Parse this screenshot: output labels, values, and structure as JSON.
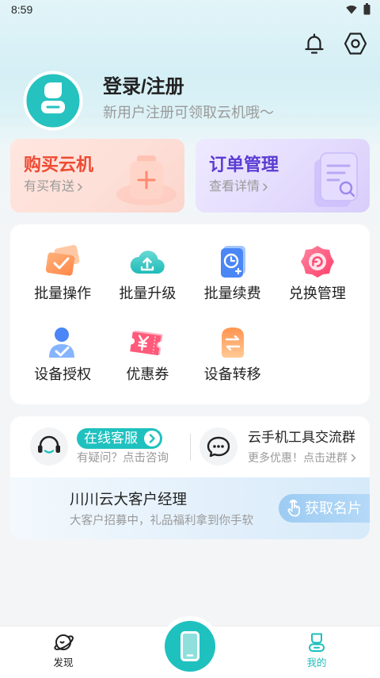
{
  "status_bar": {
    "time": "8:59",
    "icons": [
      "wifi-icon",
      "battery-icon"
    ]
  },
  "header": {
    "icons": [
      "bell-icon",
      "settings-icon"
    ]
  },
  "profile": {
    "title": "登录/注册",
    "subtitle": "新用户注册可领取云机哦～",
    "avatar_icon": "robot-avatar-icon"
  },
  "quick_cards": [
    {
      "title": "购买云机",
      "subtitle": "有买有送",
      "title_color": "#ef4a32",
      "icon": "box-plus-icon"
    },
    {
      "title": "订单管理",
      "subtitle": "查看详情",
      "title_color": "#5a3cd2",
      "icon": "order-document-icon"
    }
  ],
  "tools": [
    {
      "label": "批量操作",
      "icon": "batch-check-icon"
    },
    {
      "label": "批量升级",
      "icon": "cloud-upload-icon"
    },
    {
      "label": "批量续费",
      "icon": "renew-clock-icon"
    },
    {
      "label": "兑换管理",
      "icon": "exchange-refresh-icon"
    },
    {
      "label": "设备授权",
      "icon": "user-authorize-icon"
    },
    {
      "label": "优惠券",
      "icon": "coupon-yen-icon"
    },
    {
      "label": "设备转移",
      "icon": "transfer-arrows-icon"
    }
  ],
  "service": {
    "online_label": "在线客服",
    "online_hint": "有疑问？点击咨询",
    "group_title": "云手机工具交流群",
    "group_hint": "更多优惠！点击进群"
  },
  "banner": {
    "title": "川川云大客户经理",
    "subtitle": "大客户招募中，礼品福利拿到你手软",
    "button_label": "获取名片"
  },
  "bottom_nav": {
    "discover_label": "发现",
    "mine_label": "我的",
    "active": "我的"
  },
  "colors": {
    "accent": "#1fc1bf",
    "page_bg": "#f4f5f7",
    "text": "#222222",
    "muted": "#9a9a9a"
  }
}
